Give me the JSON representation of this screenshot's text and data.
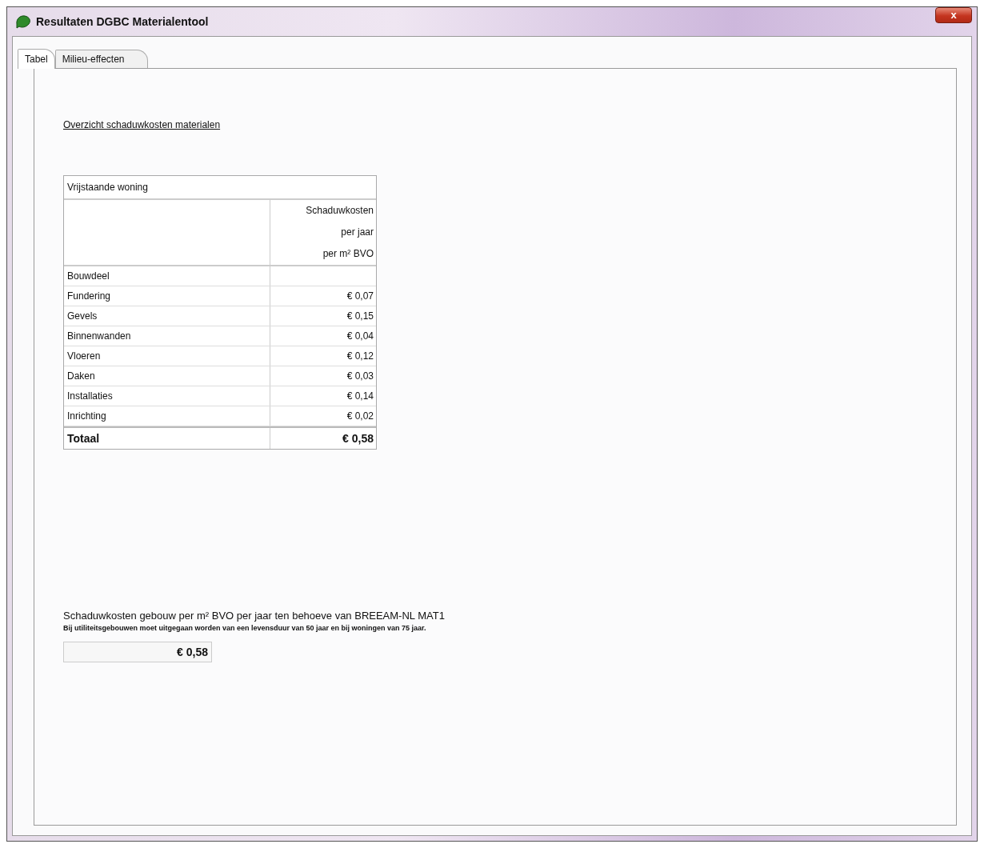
{
  "window": {
    "title": "Resultaten DGBC Materialentool",
    "close_button": "x"
  },
  "tabs": [
    {
      "label": "Tabel",
      "selected": true
    },
    {
      "label": "Milieu-effecten",
      "selected": false
    }
  ],
  "heading": "Overzicht schaduwkosten materialen",
  "table": {
    "title": "Vrijstaande woning",
    "header": [
      "Schaduwkosten",
      "per jaar",
      "per m² BVO"
    ],
    "first_column_heading": "Bouwdeel",
    "rows": [
      {
        "label": "Fundering",
        "value": "€ 0,07"
      },
      {
        "label": "Gevels",
        "value": "€ 0,15"
      },
      {
        "label": "Binnenwanden",
        "value": "€ 0,04"
      },
      {
        "label": "Vloeren",
        "value": "€ 0,12"
      },
      {
        "label": "Daken",
        "value": "€ 0,03"
      },
      {
        "label": "Installaties",
        "value": "€ 0,14"
      },
      {
        "label": "Inrichting",
        "value": "€ 0,02"
      }
    ],
    "total": {
      "label": "Totaal",
      "value": "€ 0,58"
    }
  },
  "summary": {
    "title": "Schaduwkosten gebouw per m² BVO per jaar ten behoeve van BREEAM-NL MAT1",
    "note": "Bij utiliteitsgebouwen moet uitgegaan worden van een levensduur van 50 jaar en bij woningen van 75 jaar.",
    "value": "€ 0,58"
  }
}
